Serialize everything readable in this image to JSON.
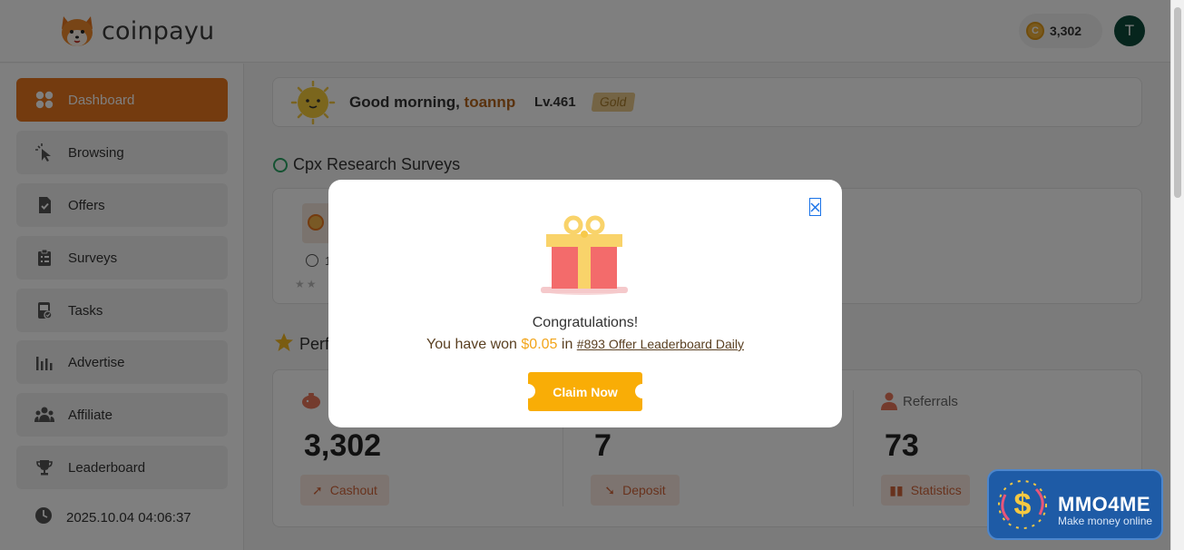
{
  "header": {
    "logo_text": "coinpayu",
    "balance": "3,302",
    "avatar_initial": "T"
  },
  "sidebar": {
    "items": [
      {
        "label": "Dashboard",
        "icon": "dashboard-icon",
        "active": true
      },
      {
        "label": "Browsing",
        "icon": "cursor-click-icon"
      },
      {
        "label": "Offers",
        "icon": "offers-icon"
      },
      {
        "label": "Surveys",
        "icon": "clipboard-icon"
      },
      {
        "label": "Tasks",
        "icon": "tasks-icon"
      },
      {
        "label": "Advertise",
        "icon": "bar-chart-icon"
      },
      {
        "label": "Affiliate",
        "icon": "users-icon"
      },
      {
        "label": "Leaderboard",
        "icon": "trophy-icon"
      }
    ],
    "datetime": "2025.10.04 04:06:37"
  },
  "greeting": {
    "prefix": "Good morning, ",
    "username": "toannp",
    "level": "Lv.461",
    "rank": "Gold"
  },
  "sections": {
    "surveys_title": "Cpx Research Surveys",
    "surveys_time_partial": "1",
    "perf_title_partial": "Perf"
  },
  "stats": [
    {
      "label": "",
      "value": "3,302",
      "button": "Cashout"
    },
    {
      "label": "",
      "value": "7",
      "button": "Deposit"
    },
    {
      "label": "Referrals",
      "value": "73",
      "button": "Statistics"
    }
  ],
  "modal": {
    "title": "Congratulations!",
    "won_prefix": "You have won ",
    "amount": "$0.05",
    "won_mid": " in ",
    "link_text": "#893 Offer Leaderboard Daily",
    "claim_label": "Claim Now"
  },
  "watermark": {
    "title": "MMO4ME",
    "subtitle": "Make money online"
  },
  "colors": {
    "accent": "#e8761f",
    "claim": "#f9ad06",
    "amount": "#f2a51b"
  }
}
